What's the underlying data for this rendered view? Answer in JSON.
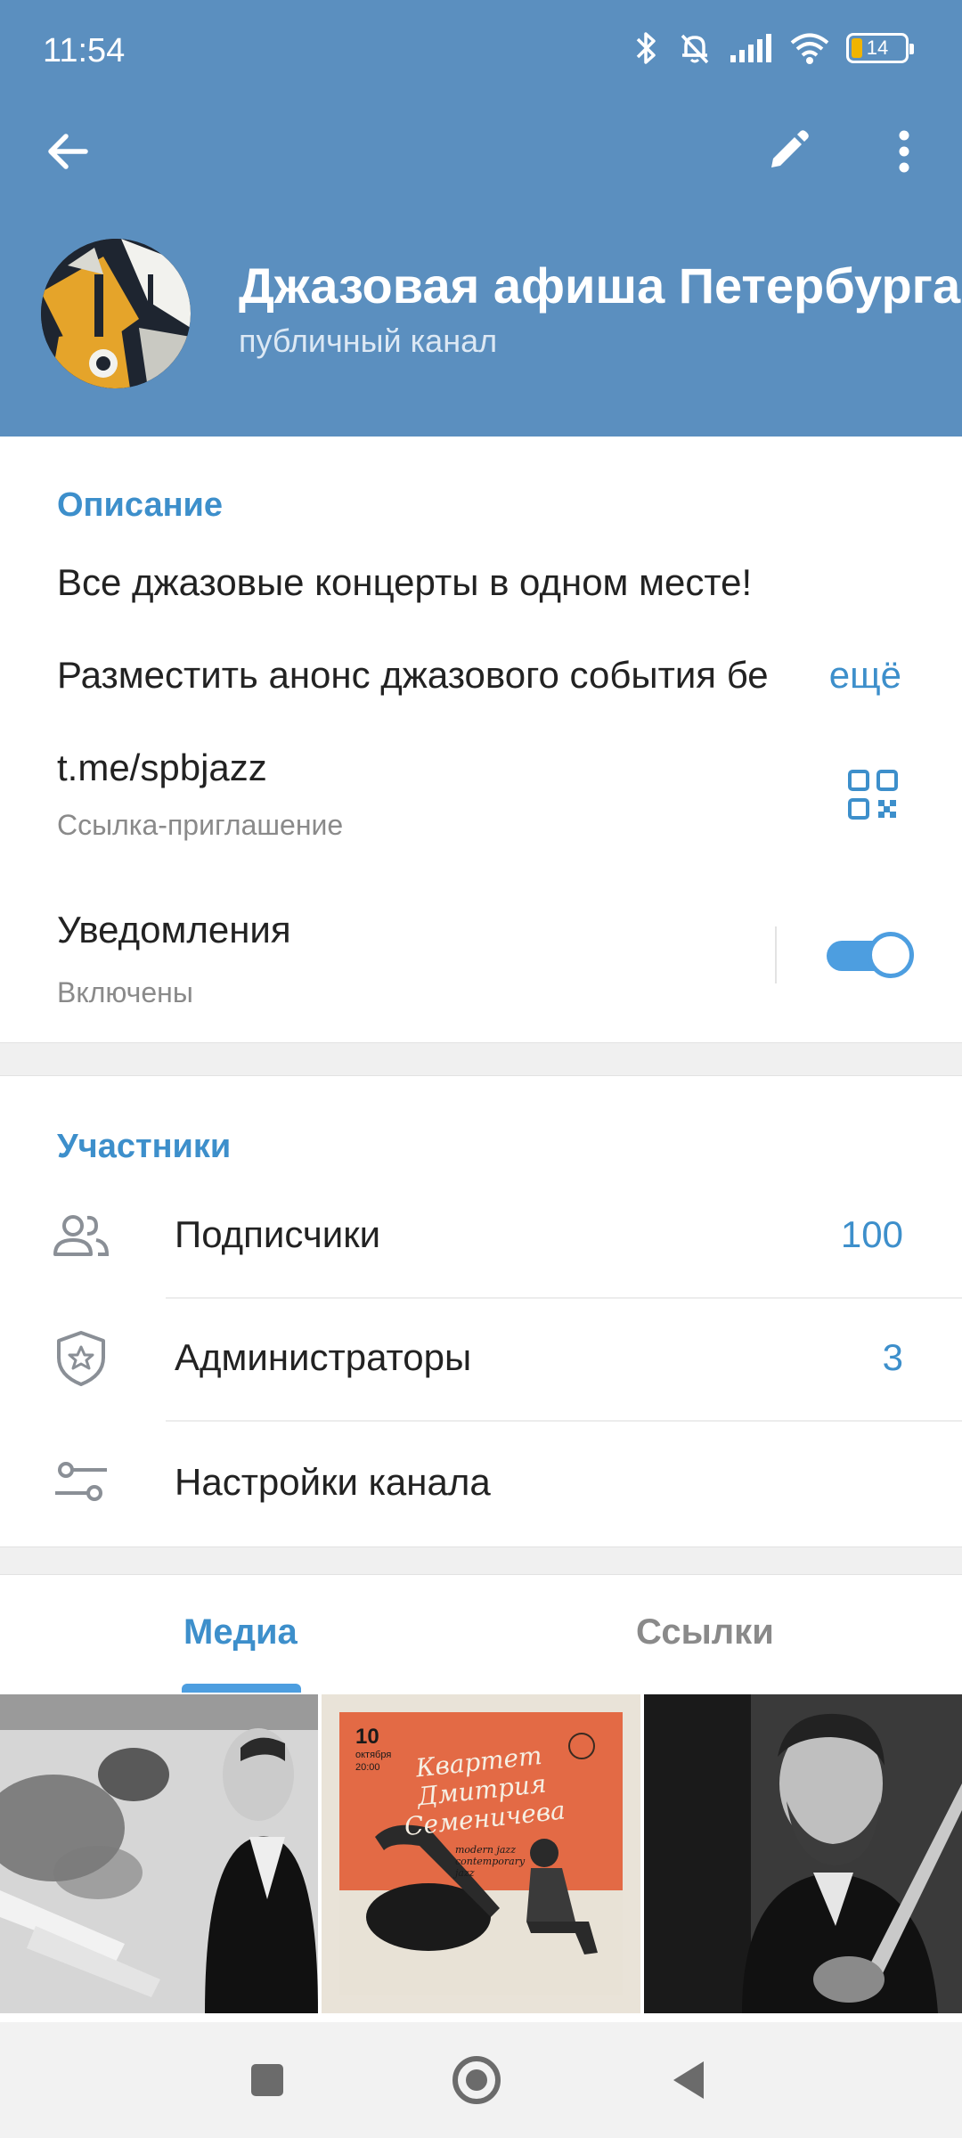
{
  "status_bar": {
    "time": "11:54",
    "battery": "14"
  },
  "header": {
    "back_icon": "arrow-left-icon",
    "edit_icon": "pencil-icon",
    "more_icon": "more-vertical-icon",
    "title": "Джазовая афиша Петербурга",
    "subtitle": "публичный канал"
  },
  "info": {
    "section_title": "Описание",
    "description_line1": "Все джазовые концерты в одном месте!",
    "description_line2": "Разместить анонс джазового события бе",
    "more_label": "ещё",
    "link": "t.me/spbjazz",
    "link_caption": "Ссылка-приглашение",
    "notifications_label": "Уведомления",
    "notifications_status": "Включены",
    "notifications_on": true
  },
  "participants": {
    "section_title": "Участники",
    "rows": [
      {
        "icon": "users-icon",
        "label": "Подписчики",
        "count": "100"
      },
      {
        "icon": "shield-star-icon",
        "label": "Администраторы",
        "count": "3"
      },
      {
        "icon": "sliders-icon",
        "label": "Настройки канала",
        "count": ""
      }
    ]
  },
  "tabs": {
    "media": "Медиа",
    "links": "Ссылки",
    "active": "media"
  },
  "media_poster": {
    "date_num": "10",
    "date_month": "октября",
    "date_time": "20:00",
    "title": "Квартет Дмитрия Семеничева",
    "subtitle": "modern jazz contemporary jazz"
  },
  "colors": {
    "header": "#5b8fbf",
    "accent": "#3d8fcb",
    "toggle": "#4d9ee0"
  }
}
